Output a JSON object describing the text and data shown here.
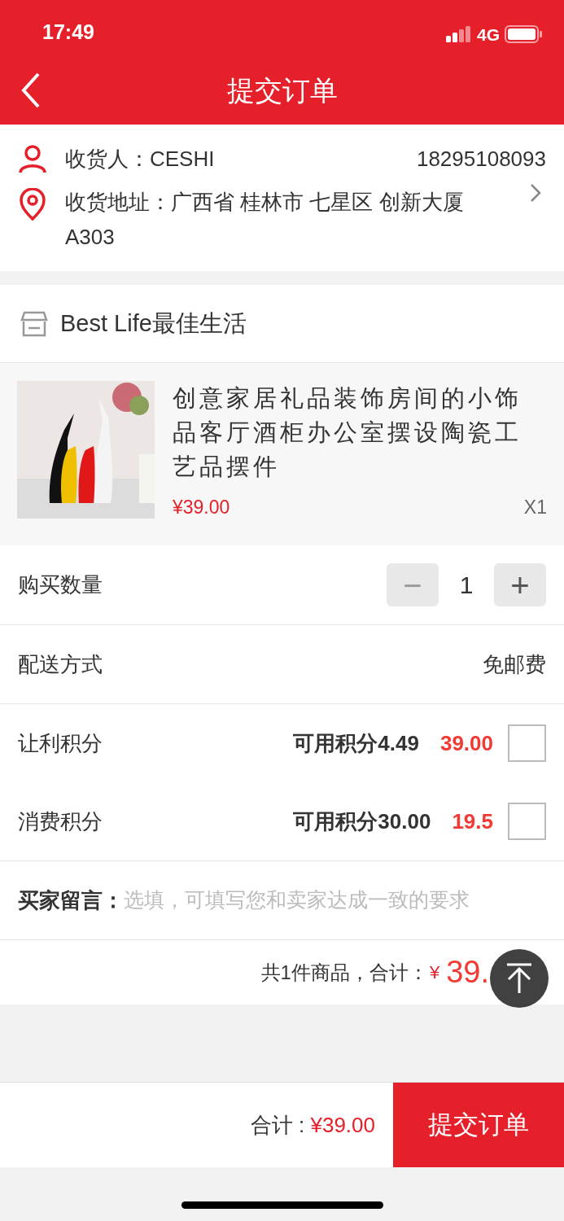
{
  "status_bar": {
    "time": "17:49",
    "network": "4G"
  },
  "nav": {
    "title": "提交订单"
  },
  "address": {
    "receiver_label": "收货人：",
    "receiver": "CESHI",
    "phone": "18295108093",
    "address_label": "收货地址：",
    "address": "广西省 桂林市 七星区 创新大厦A303"
  },
  "store": {
    "name": "Best Life最佳生活"
  },
  "product": {
    "title": "创意家居礼品装饰房间的小饰品客厅酒柜办公室摆设陶瓷工艺品摆件",
    "price": "¥39.00",
    "count": "X1"
  },
  "quantity": {
    "label": "购买数量",
    "minus": "−",
    "value": "1",
    "plus": "+"
  },
  "delivery": {
    "label": "配送方式",
    "value": "免邮费"
  },
  "points": [
    {
      "label": "让利积分",
      "available": "可用积分4.49",
      "amount": "39.00",
      "checked": false
    },
    {
      "label": "消费积分",
      "available": "可用积分30.00",
      "amount": "19.5",
      "checked": false
    }
  ],
  "message": {
    "label": "买家留言：",
    "placeholder": "选填，可填写您和卖家达成一致的要求"
  },
  "summary": {
    "text": "共1件商品，合计：",
    "currency": "¥",
    "total": "39."
  },
  "bottom_bar": {
    "label": "合计 : ",
    "total": "¥39.00",
    "submit": "提交订单"
  }
}
